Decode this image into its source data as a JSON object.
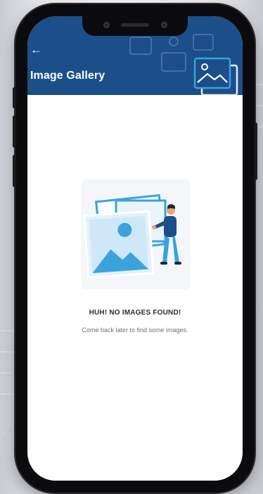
{
  "header": {
    "back_icon": "←",
    "title": "Image Gallery",
    "icon": "gallery-photos-icon"
  },
  "empty_state": {
    "illustration": "person-with-image-frames-illustration",
    "title": "HUH! NO IMAGES FOUND!",
    "subtitle": "Come back later to find some images."
  },
  "colors": {
    "header_bg": "#1c4e8a",
    "accent": "#3aa3dc",
    "screen_bg": "#ffffff",
    "phone_frame": "#0b0b0d"
  }
}
